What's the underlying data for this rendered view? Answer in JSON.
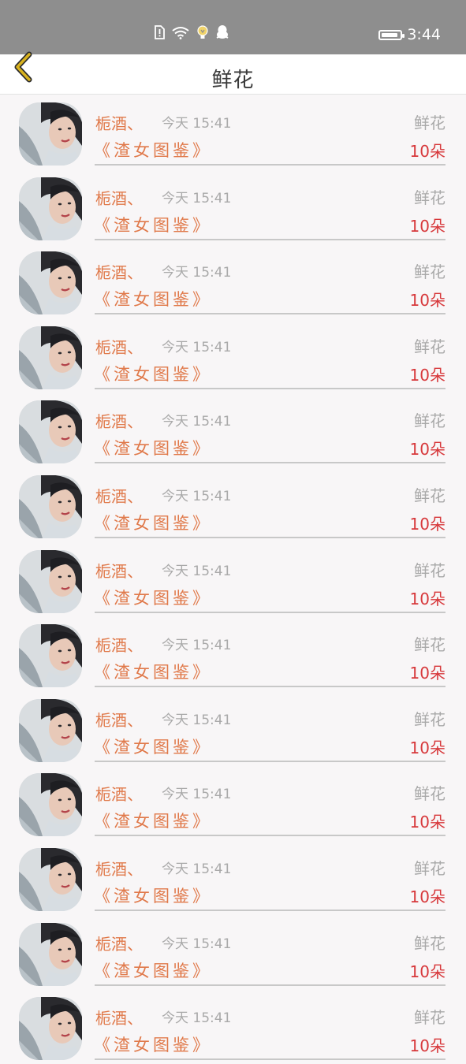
{
  "status_bar": {
    "time": "3:44",
    "icons": [
      "sim-alert-icon",
      "wifi-icon",
      "lightbulb-notification-icon",
      "qq-penguin-icon"
    ],
    "battery_level": 0.9
  },
  "header": {
    "title": "鲜花",
    "back_icon": "chevron-left-icon"
  },
  "colors": {
    "accent_name": "#e0794a",
    "count_red": "#d7383b",
    "muted": "#a9a9a9",
    "back_icon": "#d8b21f"
  },
  "items": [
    {
      "name": "栀酒、",
      "time": "今天 15:41",
      "gift": "鲜花",
      "title": "《渣女图鉴》",
      "count": "10朵"
    },
    {
      "name": "栀酒、",
      "time": "今天 15:41",
      "gift": "鲜花",
      "title": "《渣女图鉴》",
      "count": "10朵"
    },
    {
      "name": "栀酒、",
      "time": "今天 15:41",
      "gift": "鲜花",
      "title": "《渣女图鉴》",
      "count": "10朵"
    },
    {
      "name": "栀酒、",
      "time": "今天 15:41",
      "gift": "鲜花",
      "title": "《渣女图鉴》",
      "count": "10朵"
    },
    {
      "name": "栀酒、",
      "time": "今天 15:41",
      "gift": "鲜花",
      "title": "《渣女图鉴》",
      "count": "10朵"
    },
    {
      "name": "栀酒、",
      "time": "今天 15:41",
      "gift": "鲜花",
      "title": "《渣女图鉴》",
      "count": "10朵"
    },
    {
      "name": "栀酒、",
      "time": "今天 15:41",
      "gift": "鲜花",
      "title": "《渣女图鉴》",
      "count": "10朵"
    },
    {
      "name": "栀酒、",
      "time": "今天 15:41",
      "gift": "鲜花",
      "title": "《渣女图鉴》",
      "count": "10朵"
    },
    {
      "name": "栀酒、",
      "time": "今天 15:41",
      "gift": "鲜花",
      "title": "《渣女图鉴》",
      "count": "10朵"
    },
    {
      "name": "栀酒、",
      "time": "今天 15:41",
      "gift": "鲜花",
      "title": "《渣女图鉴》",
      "count": "10朵"
    },
    {
      "name": "栀酒、",
      "time": "今天 15:41",
      "gift": "鲜花",
      "title": "《渣女图鉴》",
      "count": "10朵"
    },
    {
      "name": "栀酒、",
      "time": "今天 15:41",
      "gift": "鲜花",
      "title": "《渣女图鉴》",
      "count": "10朵"
    },
    {
      "name": "栀酒、",
      "time": "今天 15:41",
      "gift": "鲜花",
      "title": "《渣女图鉴》",
      "count": "10朵"
    }
  ]
}
